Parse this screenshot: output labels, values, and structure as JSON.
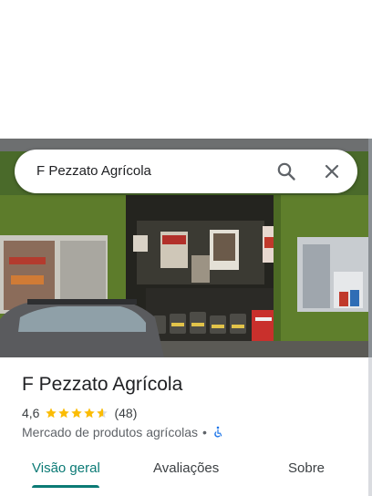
{
  "search": {
    "query": "F Pezzato Agrícola"
  },
  "place": {
    "name": "F Pezzato Agrícola",
    "rating": "4,6",
    "stars": 4.6,
    "review_count": "(48)",
    "category": "Mercado de produtos agrícolas",
    "separator": "•",
    "accessibility_icon": "wheelchair-icon"
  },
  "tabs": [
    {
      "label": "Visão geral",
      "active": true
    },
    {
      "label": "Avaliações",
      "active": false
    },
    {
      "label": "Sobre",
      "active": false
    }
  ],
  "colors": {
    "accent": "#0b7a75",
    "star": "#fbbc04",
    "accessibility": "#1a73e8"
  },
  "photo": {
    "subject": "storefront-photo"
  }
}
